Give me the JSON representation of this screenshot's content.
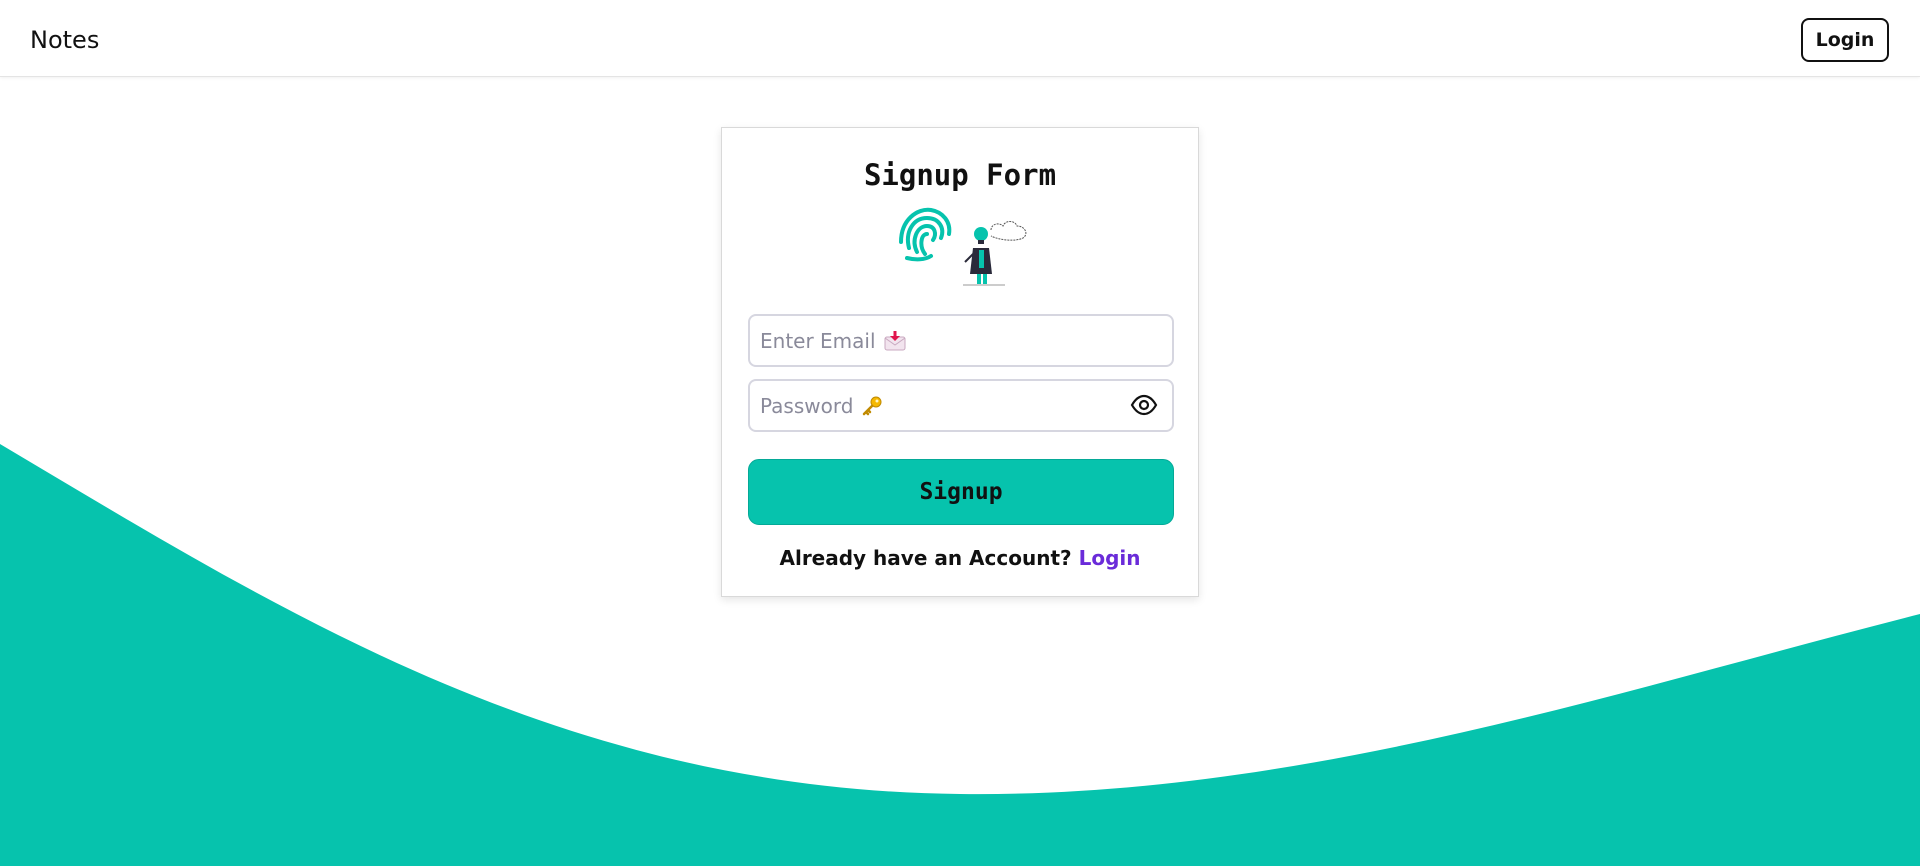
{
  "navbar": {
    "brand": "Notes",
    "login_label": "Login"
  },
  "form": {
    "title": "Signup Form",
    "email_placeholder": "Enter Email",
    "email_icon": "envelope-arrow-icon",
    "password_placeholder": "Password",
    "password_icon": "key-icon",
    "toggle_icon": "eye-icon",
    "submit_label": "Signup",
    "footer_text": "Already have an Account?",
    "footer_link": "Login"
  },
  "colors": {
    "accent": "#06c3ad",
    "link": "#6a2bd9"
  }
}
